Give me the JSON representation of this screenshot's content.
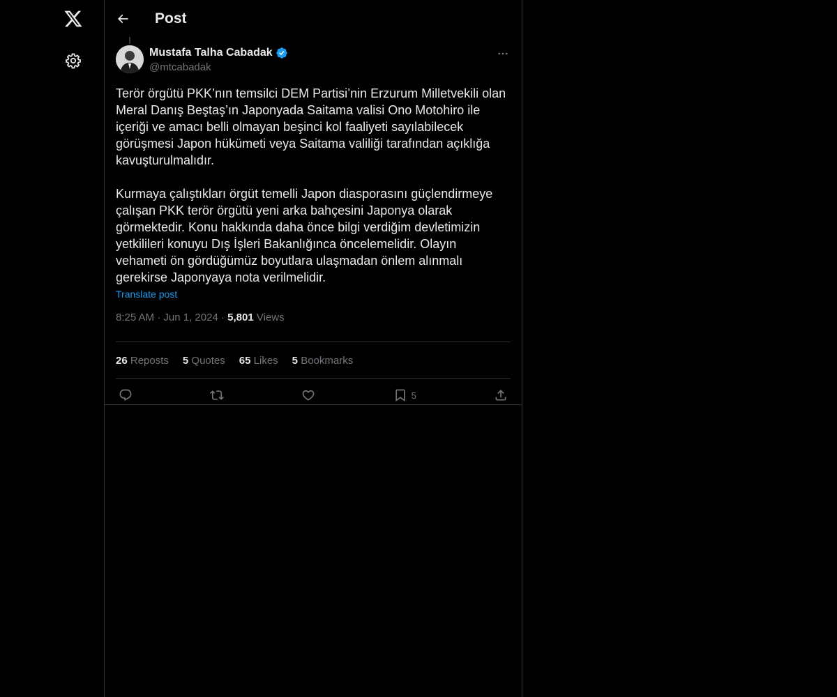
{
  "header": {
    "title": "Post"
  },
  "post": {
    "author": {
      "name": "Mustafa Talha Cabadak",
      "handle": "@mtcabadak",
      "verified": true
    },
    "text": "Terör örgütü PKK’nın temsilci DEM Partisi’nin Erzurum Milletvekili olan Meral Danış Beştaş’ın Japonyada Saitama valisi Ono Motohiro ile içeriği ve amacı belli olmayan beşinci kol faaliyeti sayılabilecek görüşmesi Japon hükümeti veya Saitama valiliği tarafından açıklığa kavuşturulmalıdır.\n\nKurmaya çalıştıkları örgüt temelli Japon diasporasını güçlendirmeye çalışan PKK terör örgütü yeni arka bahçesini Japonya olarak görmektedir. Konu hakkında daha önce bilgi verdiğim devletimizin yetkilileri konuyu Dış İşleri Bakanlığınca öncelemelidir. Olayın vehameti ön gördüğümüz boyutlara ulaşmadan önlem alınmalı gerekirse Japonyaya nota verilmelidir.",
    "translate_label": "Translate post",
    "time": "8:25 AM",
    "date": "Jun 1, 2024",
    "views_count": "5,801",
    "views_label": "Views",
    "stats": {
      "reposts_count": "26",
      "reposts_label": "Reposts",
      "quotes_count": "5",
      "quotes_label": "Quotes",
      "likes_count": "65",
      "likes_label": "Likes",
      "bookmarks_count": "5",
      "bookmarks_label": "Bookmarks"
    },
    "actions": {
      "bookmark_count": "5"
    }
  },
  "colors": {
    "background": "#000000",
    "text": "#e7e9ea",
    "secondary_text": "#71767b",
    "accent": "#1d9bf0",
    "border": "#2f3336"
  },
  "icons": [
    "x-logo-icon",
    "settings-icon",
    "back-arrow-icon",
    "verified-badge-icon",
    "more-icon",
    "reply-icon",
    "repost-icon",
    "like-icon",
    "bookmark-icon",
    "share-icon"
  ]
}
